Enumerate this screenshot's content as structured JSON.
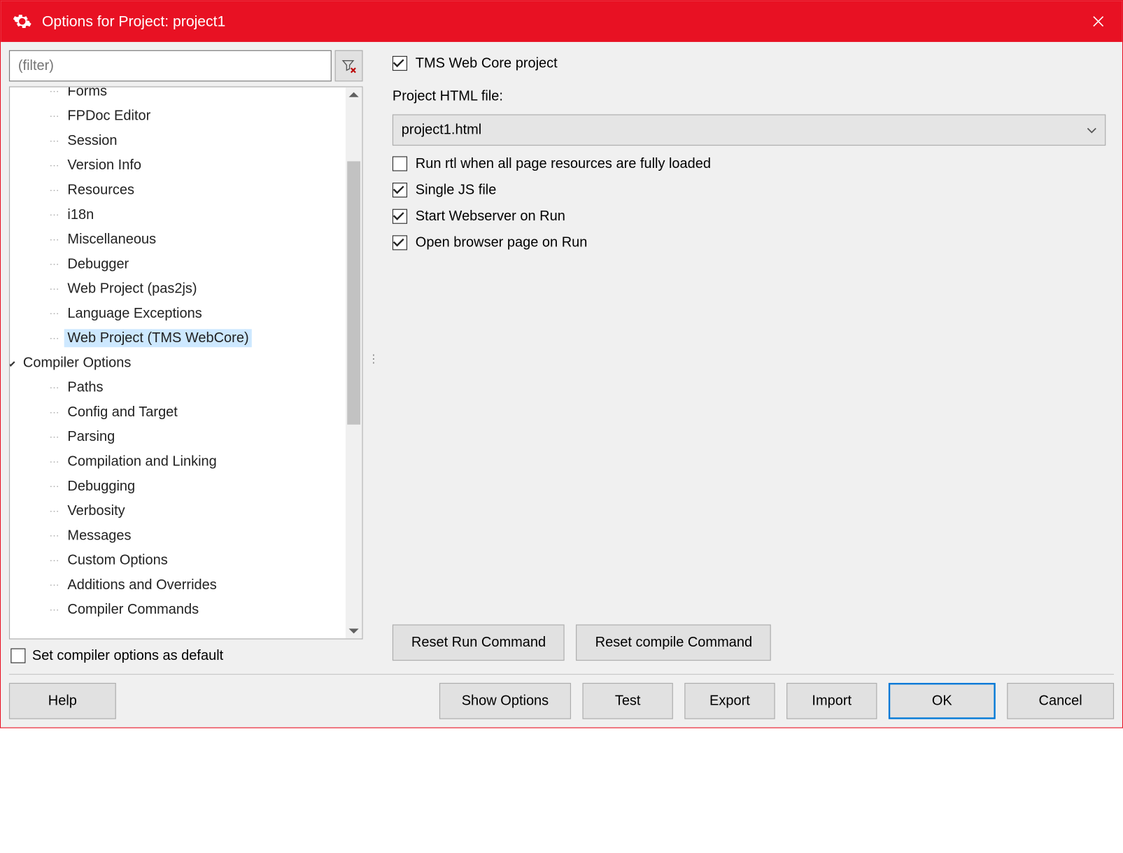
{
  "window": {
    "title": "Options for Project: project1"
  },
  "filter": {
    "placeholder": "(filter)"
  },
  "tree": {
    "items": [
      {
        "label": "Forms",
        "level": 1,
        "truncated": true
      },
      {
        "label": "FPDoc Editor",
        "level": 1
      },
      {
        "label": "Session",
        "level": 1
      },
      {
        "label": "Version Info",
        "level": 1
      },
      {
        "label": "Resources",
        "level": 1
      },
      {
        "label": "i18n",
        "level": 1
      },
      {
        "label": "Miscellaneous",
        "level": 1
      },
      {
        "label": "Debugger",
        "level": 1
      },
      {
        "label": "Web Project (pas2js)",
        "level": 1
      },
      {
        "label": "Language Exceptions",
        "level": 1
      },
      {
        "label": "Web Project (TMS WebCore)",
        "level": 1,
        "selected": true
      },
      {
        "label": "Compiler Options",
        "level": 0,
        "expandable": true
      },
      {
        "label": "Paths",
        "level": 1
      },
      {
        "label": "Config and Target",
        "level": 1
      },
      {
        "label": "Parsing",
        "level": 1
      },
      {
        "label": "Compilation and Linking",
        "level": 1
      },
      {
        "label": "Debugging",
        "level": 1
      },
      {
        "label": "Verbosity",
        "level": 1
      },
      {
        "label": "Messages",
        "level": 1
      },
      {
        "label": "Custom Options",
        "level": 1
      },
      {
        "label": "Additions and Overrides",
        "level": 1
      },
      {
        "label": "Compiler Commands",
        "level": 1
      }
    ]
  },
  "set_default_label": "Set compiler options as default",
  "panel": {
    "tms_web_core_label": "TMS Web Core project",
    "tms_web_core_checked": true,
    "html_file_label": "Project HTML file:",
    "html_file_value": "project1.html",
    "run_rtl_label": "Run rtl when all page resources are fully loaded",
    "run_rtl_checked": false,
    "single_js_label": "Single JS file",
    "single_js_checked": true,
    "start_ws_label": "Start Webserver on Run",
    "start_ws_checked": true,
    "open_browser_label": "Open browser page on Run",
    "open_browser_checked": true,
    "reset_run_label": "Reset Run Command",
    "reset_compile_label": "Reset compile Command"
  },
  "buttons": {
    "help": "Help",
    "show_options": "Show Options",
    "test": "Test",
    "export": "Export",
    "import": "Import",
    "ok": "OK",
    "cancel": "Cancel"
  }
}
